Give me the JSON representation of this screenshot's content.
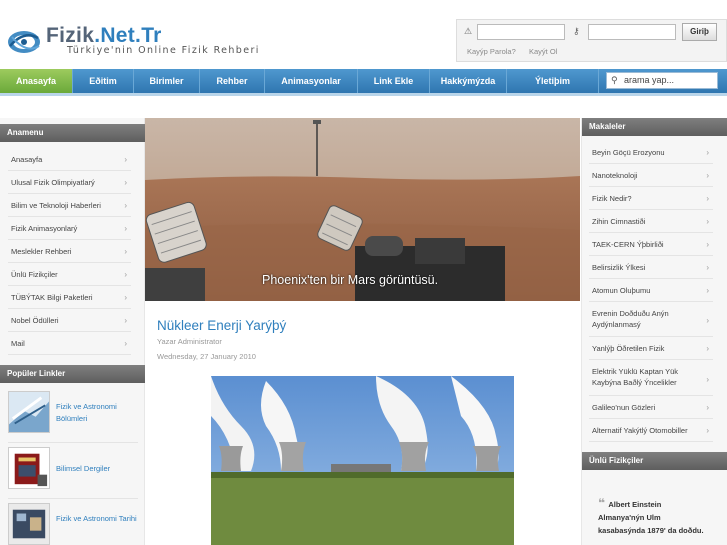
{
  "brand": {
    "name_part1": "Fizik",
    "name_part2": ".Net.Tr",
    "tagline": "Türkiye'nin Online Fizik Rehberi"
  },
  "login": {
    "forgot_password": "Kayýp Parola?",
    "register": "Kayýt Ol",
    "button": "Giriþ"
  },
  "nav": {
    "items": [
      "Anasayfa",
      "Eðitim",
      "Birimler",
      "Rehber",
      "Animasyonlar",
      "Link Ekle",
      "Hakkýmýzda",
      "Ýletiþim"
    ],
    "active": "Anasayfa",
    "search_placeholder": "arama yap..."
  },
  "left_menu": {
    "title": "Anamenu",
    "items": [
      "Anasayfa",
      "Ulusal Fizik Olimpiyatlarý",
      "Bilim ve Teknoloji Haberleri",
      "Fizik Animasyonlarý",
      "Meslekler Rehberi",
      "Ünlü Fizikçiler",
      "TÜBÝTAK Bilgi Paketleri",
      "Nobel Ödülleri",
      "Mail"
    ]
  },
  "popular_links": {
    "title": "Popüler Linkler",
    "items": [
      "Fizik ve Astronomi Bölümleri",
      "Bilimsel Dergiler",
      "Fizik ve Astronomi Tarihi"
    ]
  },
  "banner": {
    "caption": "Phoenix'ten bir Mars görüntüsü."
  },
  "article": {
    "title": "Nükleer Enerji Yarýþý",
    "author": "Yazar Administrator",
    "date": "Wednesday, 27 January 2010"
  },
  "articles_box": {
    "title": "Makaleler",
    "items": [
      "Beyin Göçü Erozyonu",
      "Nanoteknoloji",
      "Fizik Nedir?",
      "Zihin Cimnastiði",
      "TAEK-CERN Ýþbirliði",
      "Belirsizlik Ýlkesi",
      "Atomun Oluþumu",
      "Evrenin Doðduðu Anýn Aydýnlanmasý",
      "Yanlýþ Öðretilen Fizik",
      "Elektrik Yüklü Kaptan Yük Kaybýna Baðlý Ýncelikler",
      "Galileo'nun Gözleri",
      "Alternatif Yakýtlý Otomobiller"
    ]
  },
  "famous": {
    "title": "Ünlü Fizikçiler",
    "quote": "Albert Einstein Almanya'nýn Ulm kasabasýnda 1879' da doðdu."
  },
  "colors": {
    "accent": "#2f7fbd",
    "nav": "#3b84bf",
    "active": "#7fb54a",
    "box_header": "#6c6c6c"
  }
}
